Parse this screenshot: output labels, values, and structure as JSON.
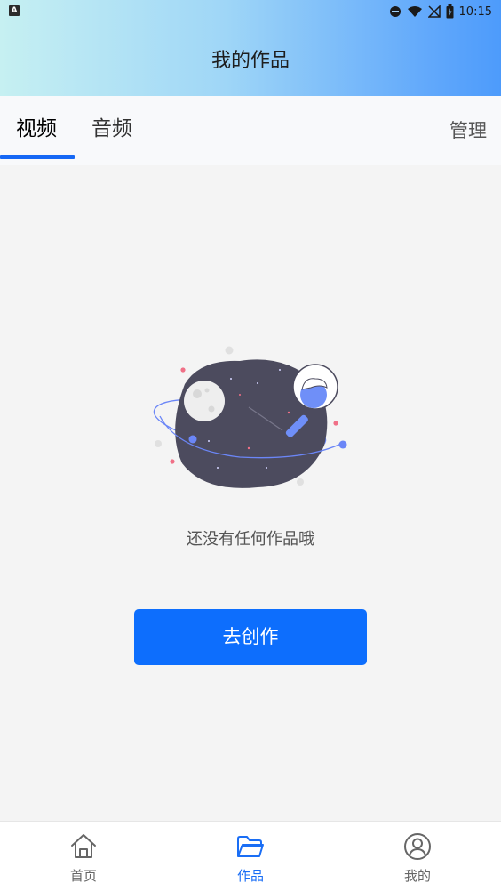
{
  "status_bar": {
    "badge": "A",
    "time": "10:15"
  },
  "header": {
    "title": "我的作品"
  },
  "tabs": {
    "items": [
      {
        "label": "视频",
        "active": true
      },
      {
        "label": "音频",
        "active": false
      }
    ],
    "manage_label": "管理"
  },
  "empty_state": {
    "message": "还没有任何作品哦",
    "create_button": "去创作"
  },
  "bottom_nav": {
    "items": [
      {
        "label": "首页",
        "icon": "home-icon",
        "active": false
      },
      {
        "label": "作品",
        "icon": "folder-icon",
        "active": true
      },
      {
        "label": "我的",
        "icon": "user-icon",
        "active": false
      }
    ]
  },
  "colors": {
    "accent": "#0d6efd",
    "tab_indicator": "#1668f5",
    "header_gradient_start": "#c6f0f2",
    "header_gradient_end": "#4d9bfb"
  }
}
